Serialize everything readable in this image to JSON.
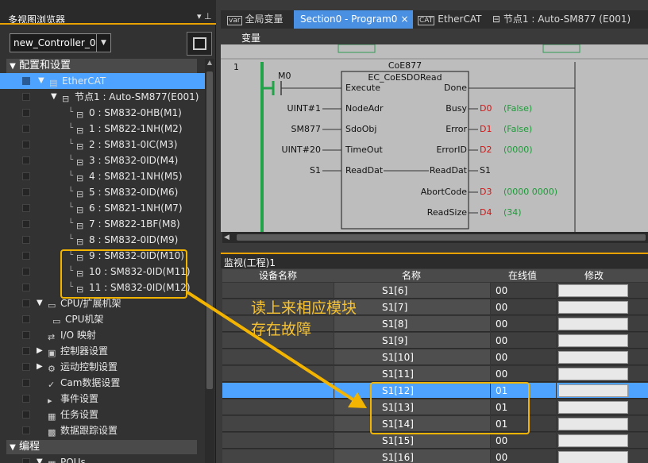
{
  "left_panel": {
    "title": "多视图浏览器",
    "pin": "▾ 📌",
    "controller": "new_Controller_0",
    "sections": [
      {
        "label": "配置和设置"
      },
      {
        "label": "编程"
      }
    ],
    "tree": [
      {
        "label": "EtherCAT",
        "icon": "▤",
        "twisty": "▼"
      },
      {
        "label": "节点1 : Auto-SM877(E001)",
        "icon": "⊟",
        "twisty": "▼"
      },
      {
        "label": "0 : SM832-0HB(M1)",
        "icon": "⊟"
      },
      {
        "label": "1 : SM822-1NH(M2)",
        "icon": "⊟"
      },
      {
        "label": "2 : SM831-0IC(M3)",
        "icon": "⊟"
      },
      {
        "label": "3 : SM832-0ID(M4)",
        "icon": "⊟"
      },
      {
        "label": "4 : SM821-1NH(M5)",
        "icon": "⊟"
      },
      {
        "label": "5 : SM832-0ID(M6)",
        "icon": "⊟"
      },
      {
        "label": "6 : SM821-1NH(M7)",
        "icon": "⊟"
      },
      {
        "label": "7 : SM822-1BF(M8)",
        "icon": "⊟"
      },
      {
        "label": "8 : SM832-0ID(M9)",
        "icon": "⊟"
      },
      {
        "label": "9 : SM832-0ID(M10)",
        "icon": "⊟"
      },
      {
        "label": "10 : SM832-0ID(M11)",
        "icon": "⊟"
      },
      {
        "label": "11 : SM832-0ID(M12)",
        "icon": "⊟"
      },
      {
        "label": "CPU/扩展机架",
        "icon": "▭",
        "twisty": "▼"
      },
      {
        "label": "CPU机架",
        "icon": "▭"
      },
      {
        "label": "I/O 映射",
        "icon": "⇄"
      },
      {
        "label": "控制器设置",
        "icon": "▣",
        "twisty": "▶"
      },
      {
        "label": "运动控制设置",
        "icon": "⚙",
        "twisty": "▶"
      },
      {
        "label": "Cam数据设置",
        "icon": "✓"
      },
      {
        "label": "事件设置",
        "icon": "▸"
      },
      {
        "label": "任务设置",
        "icon": "▦"
      },
      {
        "label": "数据跟踪设置",
        "icon": "▩"
      },
      {
        "label": "POUs",
        "icon": "▦",
        "twisty": "▼"
      }
    ]
  },
  "tabs": [
    {
      "label": "全局变量",
      "icon": "var"
    },
    {
      "label": "Section0 - Program0",
      "close": "×"
    },
    {
      "label": "EtherCAT",
      "icon": "CAT"
    },
    {
      "label": "节点1 : Auto-SM877 (E001)",
      "icon": "⊟"
    }
  ],
  "subbar": {
    "label": "变量"
  },
  "ladder": {
    "rung": "1",
    "contact": "M0",
    "fb_instance": "CoE877",
    "fb_type": "EC_CoESDORead",
    "inputs": [
      {
        "pin": "Execute",
        "var": ""
      },
      {
        "pin": "NodeAdr",
        "var": "UINT#1"
      },
      {
        "pin": "SdoObj",
        "var": "SM877"
      },
      {
        "pin": "TimeOut",
        "var": "UINT#20"
      },
      {
        "pin": "ReadDat",
        "var": "S1"
      }
    ],
    "outputs": [
      {
        "pin": "Done",
        "var": "",
        "value": ""
      },
      {
        "pin": "Busy",
        "var": "D0",
        "value": "(False)"
      },
      {
        "pin": "Error",
        "var": "D1",
        "value": "(False)"
      },
      {
        "pin": "ErrorID",
        "var": "D2",
        "value": "(0000)"
      },
      {
        "pin": "ReadDat",
        "var": "S1",
        "value": ""
      },
      {
        "pin": "AbortCode",
        "var": "D3",
        "value": "(0000 0000)"
      },
      {
        "pin": "ReadSize",
        "var": "D4",
        "value": "(34)"
      }
    ]
  },
  "watch": {
    "title": "监视(工程)1",
    "headers": {
      "device": "设备名称",
      "name": "名称",
      "online": "在线值",
      "modify": "修改"
    },
    "rows": [
      {
        "name": "S1[6]",
        "value": "00"
      },
      {
        "name": "S1[7]",
        "value": "00"
      },
      {
        "name": "S1[8]",
        "value": "00"
      },
      {
        "name": "S1[9]",
        "value": "00"
      },
      {
        "name": "S1[10]",
        "value": "00"
      },
      {
        "name": "S1[11]",
        "value": "00"
      },
      {
        "name": "S1[12]",
        "value": "01"
      },
      {
        "name": "S1[13]",
        "value": "01"
      },
      {
        "name": "S1[14]",
        "value": "01"
      },
      {
        "name": "S1[15]",
        "value": "00"
      },
      {
        "name": "S1[16]",
        "value": "00"
      }
    ]
  },
  "annotation": {
    "line1": "读上来相应模块",
    "line2": "存在故障",
    "color": "#f2b400"
  },
  "colors": {
    "accent": "#e8a100",
    "selection": "#4da3ff",
    "ladder_bg": "#bdbdbd",
    "rail": "#22a34a",
    "value_green": "#1f9a3a",
    "var_red": "#d21414"
  }
}
